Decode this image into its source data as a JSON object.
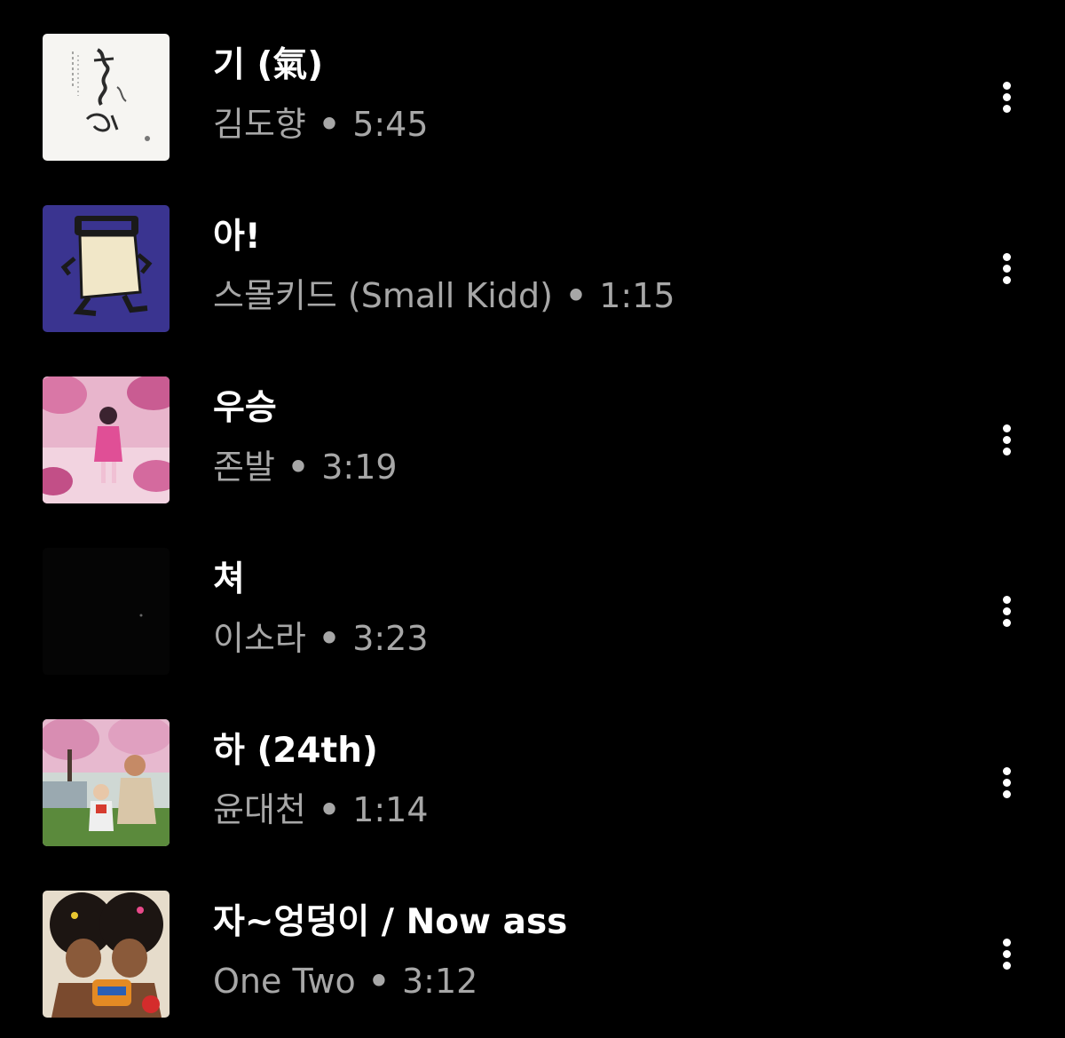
{
  "tracks": [
    {
      "title": "기 (氣)",
      "artist": "김도향",
      "separator": "•",
      "duration": "5:45",
      "art": "calligraphy-album-art",
      "menu_icon": "more-vert-icon"
    },
    {
      "title": "아!",
      "artist": "스몰키드 (Small Kidd)",
      "separator": "•",
      "duration": "1:15",
      "art": "paper-bag-album-art",
      "menu_icon": "more-vert-icon"
    },
    {
      "title": "우승",
      "artist": "존발",
      "separator": "•",
      "duration": "3:19",
      "art": "pink-blossom-album-art",
      "menu_icon": "more-vert-icon"
    },
    {
      "title": "쳐",
      "artist": "이소라",
      "separator": "•",
      "duration": "3:23",
      "art": "black-album-art",
      "menu_icon": "more-vert-icon"
    },
    {
      "title": "하 (24th)",
      "artist": "윤대천",
      "separator": "•",
      "duration": "1:14",
      "art": "cherry-tree-photo-album-art",
      "menu_icon": "more-vert-icon"
    },
    {
      "title": "자~엉덩이 / Now ass",
      "artist": "One Two",
      "separator": "•",
      "duration": "3:12",
      "art": "afro-duo-album-art",
      "menu_icon": "more-vert-icon"
    }
  ],
  "colors": {
    "background": "#000000",
    "title": "#ffffff",
    "subtitle": "#a7a7a7"
  }
}
